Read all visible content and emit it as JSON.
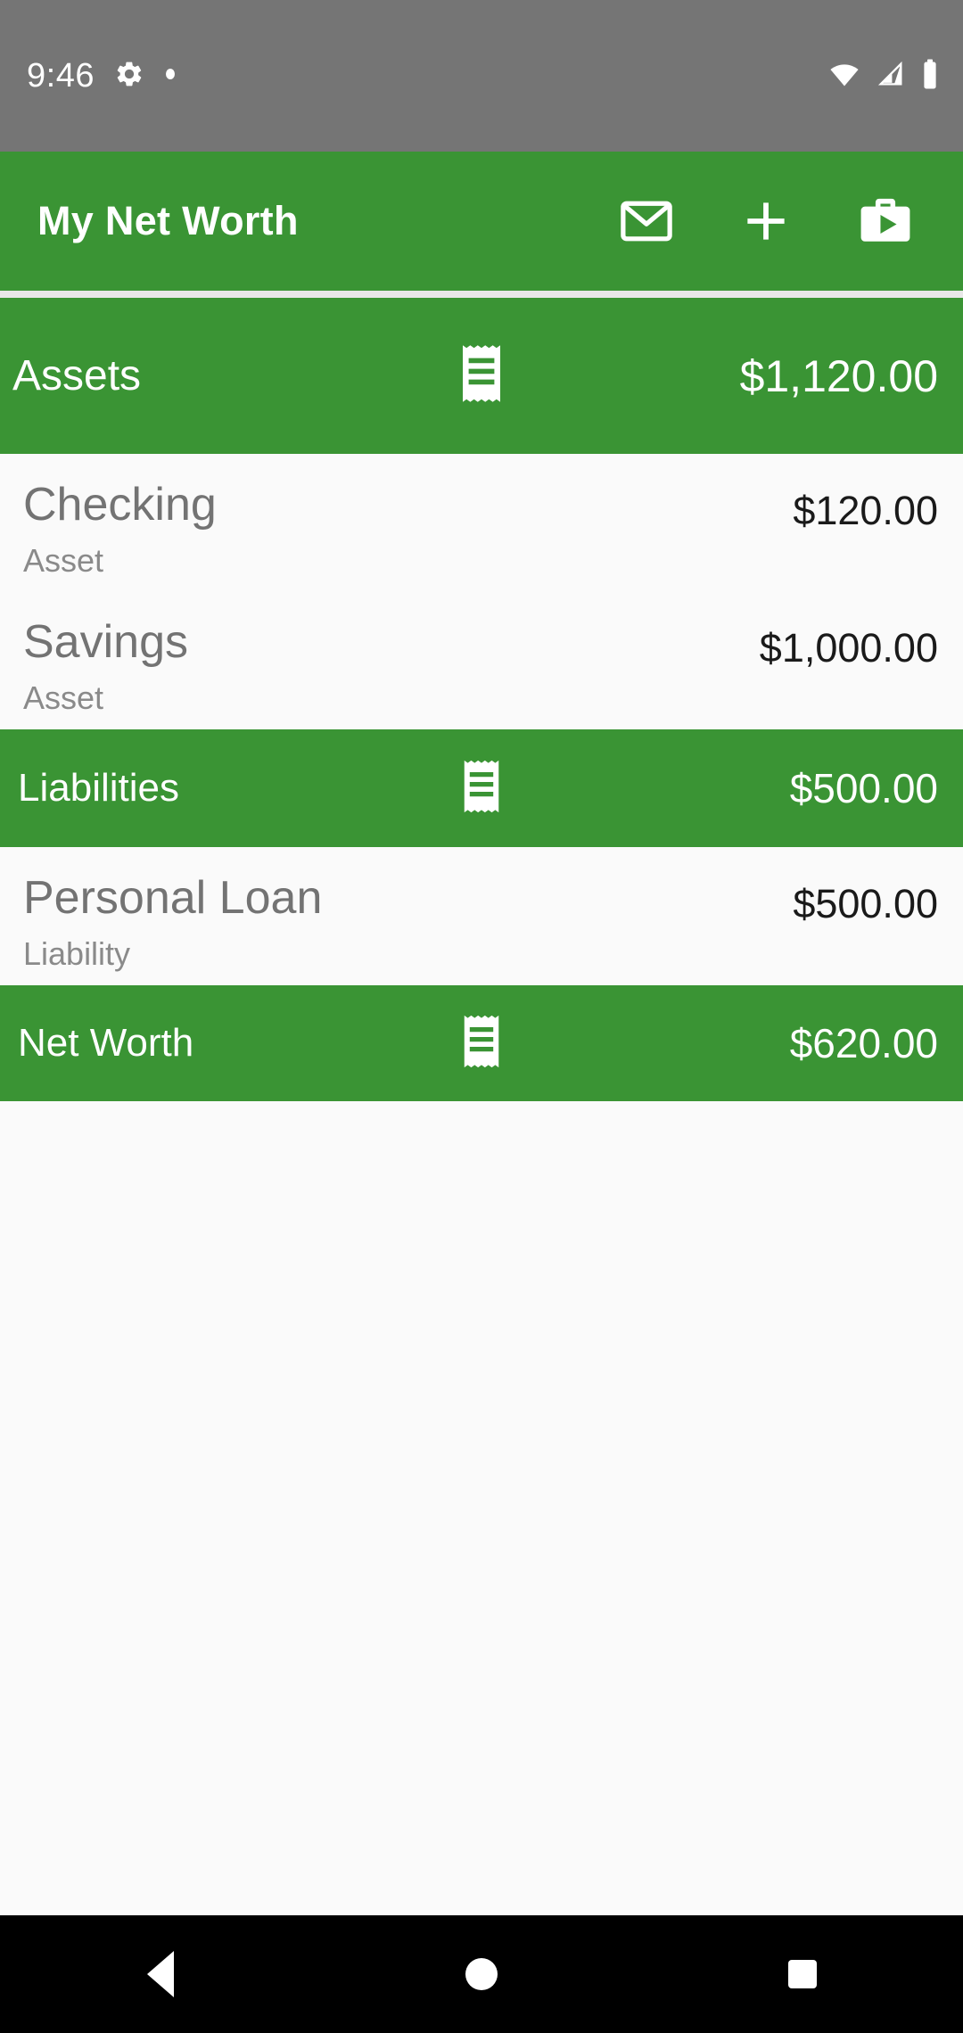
{
  "status_bar": {
    "time": "9:46",
    "icons_left": [
      "gear-icon",
      "dot-icon"
    ],
    "icons_right": [
      "wifi-icon",
      "cell-signal-icon",
      "battery-icon"
    ],
    "background_color": "#757575"
  },
  "app_bar": {
    "title": "My Net Worth",
    "background_color": "#3a9434",
    "actions": [
      {
        "name": "email-icon",
        "label": "Email"
      },
      {
        "name": "add-icon",
        "label": "Add"
      },
      {
        "name": "briefcase-play-icon",
        "label": "Portfolio"
      }
    ]
  },
  "sections": {
    "assets": {
      "label": "Assets",
      "amount": "$1,120.00",
      "icon": "receipt-icon",
      "items": [
        {
          "title": "Checking",
          "subtitle": "Asset",
          "amount": "$120.00"
        },
        {
          "title": "Savings",
          "subtitle": "Asset",
          "amount": "$1,000.00"
        }
      ]
    },
    "liabilities": {
      "label": "Liabilities",
      "amount": "$500.00",
      "icon": "receipt-icon",
      "items": [
        {
          "title": "Personal Loan",
          "subtitle": "Liability",
          "amount": "$500.00"
        }
      ]
    },
    "net_worth": {
      "label": "Net Worth",
      "amount": "$620.00",
      "icon": "receipt-icon"
    }
  },
  "nav_bar": {
    "background_color": "#000000",
    "buttons": [
      {
        "name": "back-button",
        "label": "Back"
      },
      {
        "name": "home-button",
        "label": "Home"
      },
      {
        "name": "recents-button",
        "label": "Recents"
      }
    ]
  },
  "colors": {
    "brand_green": "#3a9434",
    "status_gray": "#757575",
    "list_background": "#fafafa",
    "title_gray": "#737373",
    "subtitle_gray": "#8a8a8a",
    "amount_dark": "#1a1a1a"
  }
}
